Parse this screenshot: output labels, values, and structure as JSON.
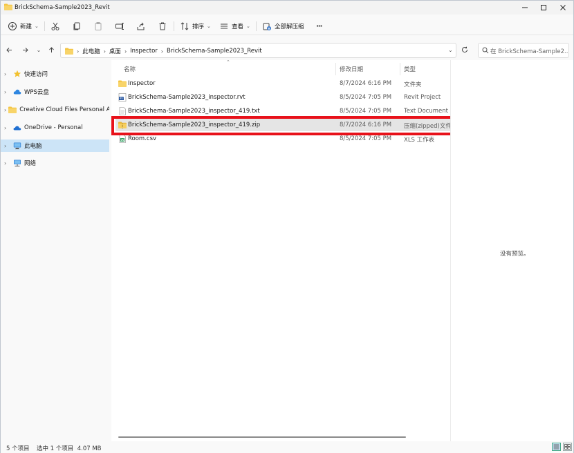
{
  "window": {
    "title": "BrickSchema-Sample2023_Revit"
  },
  "toolbar": {
    "new_label": "新建",
    "sort_label": "排序",
    "view_label": "查看",
    "extract_label": "全部解压缩",
    "more_label": "···"
  },
  "address": {
    "crumbs": [
      "此电脑",
      "桌面",
      "Inspector",
      "BrickSchema-Sample2023_Revit"
    ],
    "search_placeholder": "在 BrickSchema-Sample2..."
  },
  "sidebar": {
    "items": [
      {
        "label": "快速访问",
        "icon": "star-icon"
      },
      {
        "label": "WPS云盘",
        "icon": "cloud-icon"
      },
      {
        "label": "Creative Cloud Files Personal Acc",
        "icon": "folder-icon"
      },
      {
        "label": "OneDrive - Personal",
        "icon": "onedrive-icon"
      },
      {
        "label": "此电脑",
        "icon": "pc-icon",
        "selected": true
      },
      {
        "label": "网络",
        "icon": "network-icon"
      }
    ]
  },
  "columns": {
    "name": "名称",
    "date": "修改日期",
    "type": "类型"
  },
  "files": [
    {
      "name": "Inspector",
      "date": "8/7/2024 6:16 PM",
      "type": "文件夹",
      "icon": "folder-icon"
    },
    {
      "name": "BrickSchema-Sample2023_inspector.rvt",
      "date": "8/5/2024 7:05 PM",
      "type": "Revit Project",
      "icon": "rvt-icon"
    },
    {
      "name": "BrickSchema-Sample2023_inspector_419.txt",
      "date": "8/5/2024 7:05 PM",
      "type": "Text Document",
      "icon": "txt-icon"
    },
    {
      "name": "BrickSchema-Sample2023_inspector_419.zip",
      "date": "8/7/2024 6:16 PM",
      "type": "压缩(zipped)文件...",
      "icon": "zip-folder-icon",
      "selected": true
    },
    {
      "name": "Room.csv",
      "date": "8/5/2024 7:05 PM",
      "type": "XLS 工作表",
      "icon": "csv-icon"
    }
  ],
  "preview": {
    "empty_text": "没有预览。"
  },
  "status": {
    "count": "5 个项目",
    "selection": "选中 1 个项目  4.07 MB"
  },
  "colors": {
    "selected": "#cce4f7",
    "highlight": "#e8111a",
    "folder": "#f4c542"
  }
}
